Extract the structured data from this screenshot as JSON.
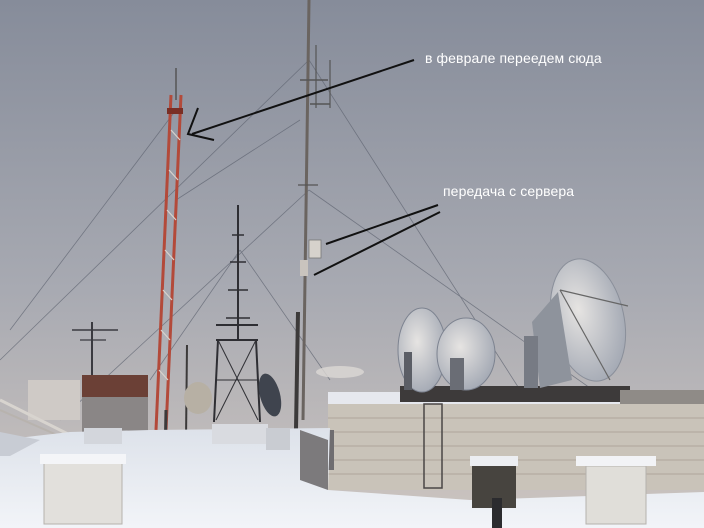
{
  "annotations": {
    "move_here": "в феврале переедем сюда",
    "server_transmission": "передача с сервера"
  },
  "colors": {
    "sky_top": "#8a909e",
    "sky_bottom": "#c9c2be",
    "snow": "#e9ecf2",
    "mast_red": "#b34a3a",
    "dish": "#c8ccd6",
    "arrow": "#111111"
  }
}
